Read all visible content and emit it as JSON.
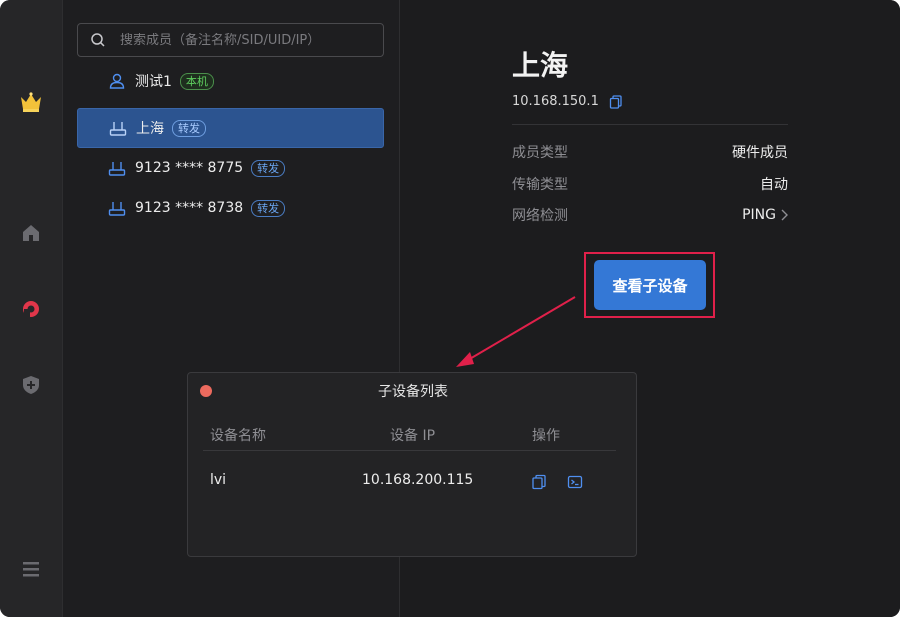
{
  "sidebar": {
    "icons": [
      "crown-icon",
      "home-icon",
      "network-icon",
      "shield-plus-icon",
      "menu-icon"
    ]
  },
  "search": {
    "placeholder": "搜索成员（备注名称/SID/UID/IP）"
  },
  "members": [
    {
      "name": "测试1",
      "badge": "本机",
      "badge_type": "local",
      "icon": "user-icon",
      "selected": false
    },
    {
      "name": "上海",
      "badge": "转发",
      "badge_type": "relay",
      "icon": "router-icon",
      "selected": true
    },
    {
      "name": "9123 **** 8775",
      "badge": "转发",
      "badge_type": "relay",
      "icon": "router-icon",
      "selected": false
    },
    {
      "name": "9123 **** 8738",
      "badge": "转发",
      "badge_type": "relay",
      "icon": "router-icon",
      "selected": false
    }
  ],
  "detail": {
    "title": "上海",
    "ip": "10.168.150.1",
    "rows": [
      {
        "key": "成员类型",
        "value": "硬件成员"
      },
      {
        "key": "传输类型",
        "value": "自动"
      },
      {
        "key": "网络检测",
        "value": "PING"
      }
    ],
    "view_button": "查看子设备"
  },
  "dialog": {
    "title": "子设备列表",
    "columns": [
      "设备名称",
      "设备 IP",
      "操作"
    ],
    "rows": [
      {
        "name": "lvi",
        "ip": "10.168.200.115"
      }
    ]
  },
  "colors": {
    "accent": "#3478d6",
    "highlight_frame": "#e0204a",
    "selected_row": "#2c5490"
  }
}
